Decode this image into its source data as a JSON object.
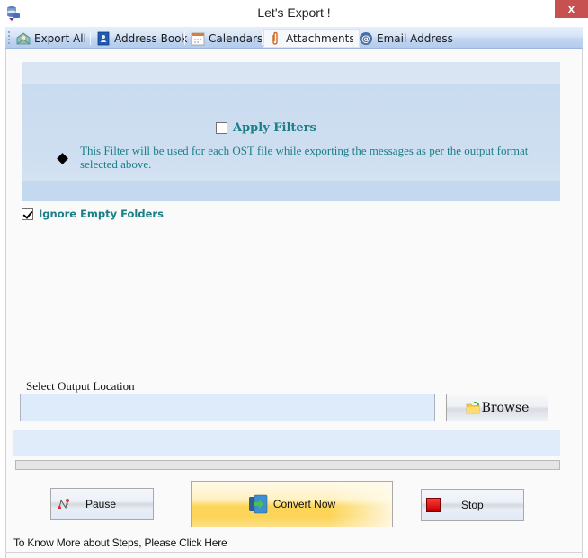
{
  "window": {
    "title": "Let's Export !",
    "close_label": "x"
  },
  "toolbar": {
    "tabs": [
      {
        "label": "Export All",
        "icon": "export-envelope-icon",
        "active": false
      },
      {
        "label": "Address Book",
        "icon": "address-book-icon",
        "active": false
      },
      {
        "label": "Calendars",
        "icon": "calendar-icon",
        "active": false
      },
      {
        "label": "Attachments",
        "icon": "paperclip-icon",
        "active": true
      },
      {
        "label": "Email Address",
        "icon": "at-sign-icon",
        "active": false
      }
    ]
  },
  "filters": {
    "apply_label": "Apply Filters",
    "apply_checked": false,
    "note": "This Filter will be used for each OST file while exporting the messages as per the output format selected above."
  },
  "options": {
    "ignore_empty_label": "Ignore Empty Folders",
    "ignore_empty_checked": true
  },
  "output": {
    "label": "Select Output Location",
    "value": "",
    "placeholder": "",
    "browse_label": "Browse"
  },
  "status": {
    "text": "",
    "progress": 0
  },
  "actions": {
    "pause_label": "Pause",
    "convert_label": "Convert Now",
    "stop_label": "Stop"
  },
  "footer": {
    "help_text": "To Know More about Steps, Please Click Here"
  },
  "colors": {
    "accent_text": "#1b7f86",
    "close_button": "#c75050",
    "convert_button": "#fcd557",
    "stop_icon": "#d40000"
  }
}
